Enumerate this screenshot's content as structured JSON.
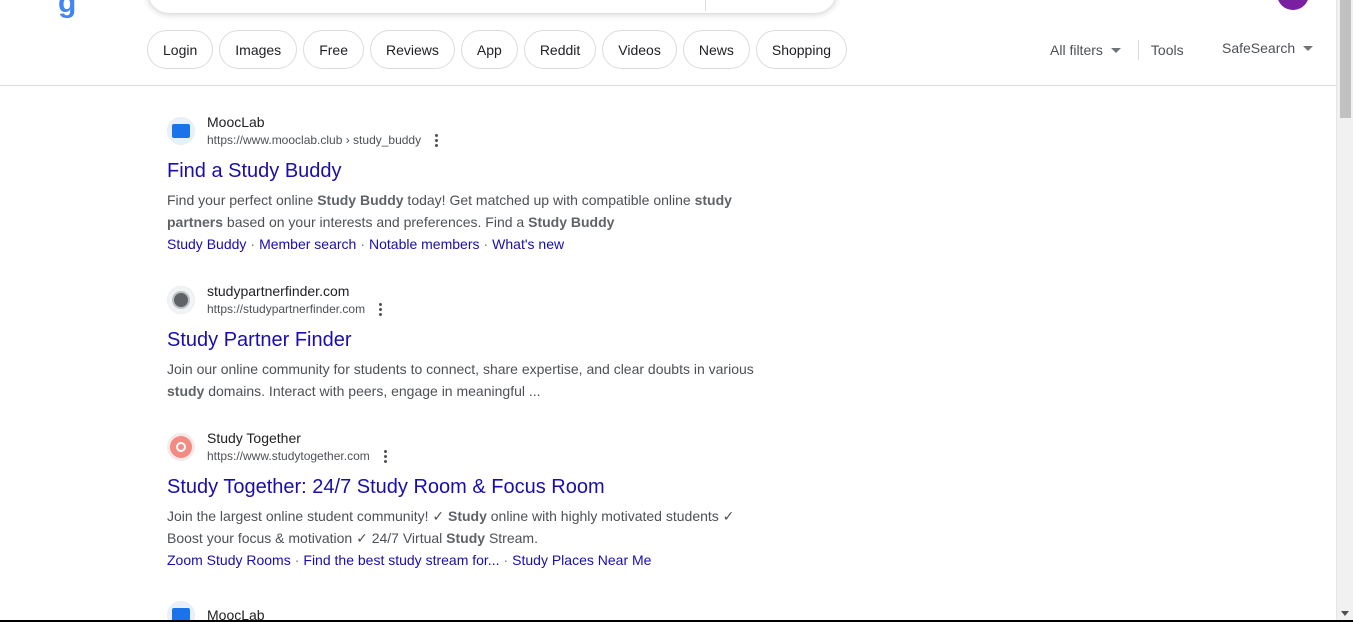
{
  "header": {
    "logo_fragment": "g"
  },
  "chips": [
    "Login",
    "Images",
    "Free",
    "Reviews",
    "App",
    "Reddit",
    "Videos",
    "News",
    "Shopping"
  ],
  "filters": {
    "all_filters": "All filters",
    "tools": "Tools",
    "safesearch": "SafeSearch"
  },
  "colors": {
    "link": "#1a0dab",
    "text": "#202124",
    "snippet": "#4d5156",
    "avatar": "#7b1fa2"
  },
  "results": [
    {
      "site_name": "MoocLab",
      "url": "https://www.mooclab.club › study_buddy",
      "title": "Find a Study Buddy",
      "snippet_html": "Find your perfect online <b>Study Buddy</b> today! Get matched up with compatible online <b>study partners</b> based on your interests and preferences. Find a <b>Study Buddy</b>",
      "sitelinks": [
        "Study Buddy",
        "Member search",
        "Notable members",
        "What's new"
      ],
      "favicon": "mooclab-icon"
    },
    {
      "site_name": "studypartnerfinder.com",
      "url": "https://studypartnerfinder.com",
      "title": "Study Partner Finder",
      "snippet_html": "Join our online community for students to connect, share expertise, and clear doubts in various <b>study</b> domains. Interact with peers, engage in meaningful ...",
      "sitelinks": [],
      "favicon": "studypartnerfinder-icon"
    },
    {
      "site_name": "Study Together",
      "url": "https://www.studytogether.com",
      "title": "Study Together: 24/7 Study Room & Focus Room",
      "snippet_html": "Join the largest online student community! ✓ <b>Study</b> online with highly motivated students ✓ Boost your focus &amp; motivation ✓ 24/7 Virtual <b>Study</b> Stream.",
      "sitelinks": [
        "Zoom Study Rooms",
        "Find the best study stream for...",
        "Study Places Near Me"
      ],
      "favicon": "studytogether-icon"
    },
    {
      "site_name": "MoocLab",
      "url": "",
      "title": "",
      "snippet_html": "",
      "sitelinks": [],
      "favicon": "mooclab-icon"
    }
  ]
}
